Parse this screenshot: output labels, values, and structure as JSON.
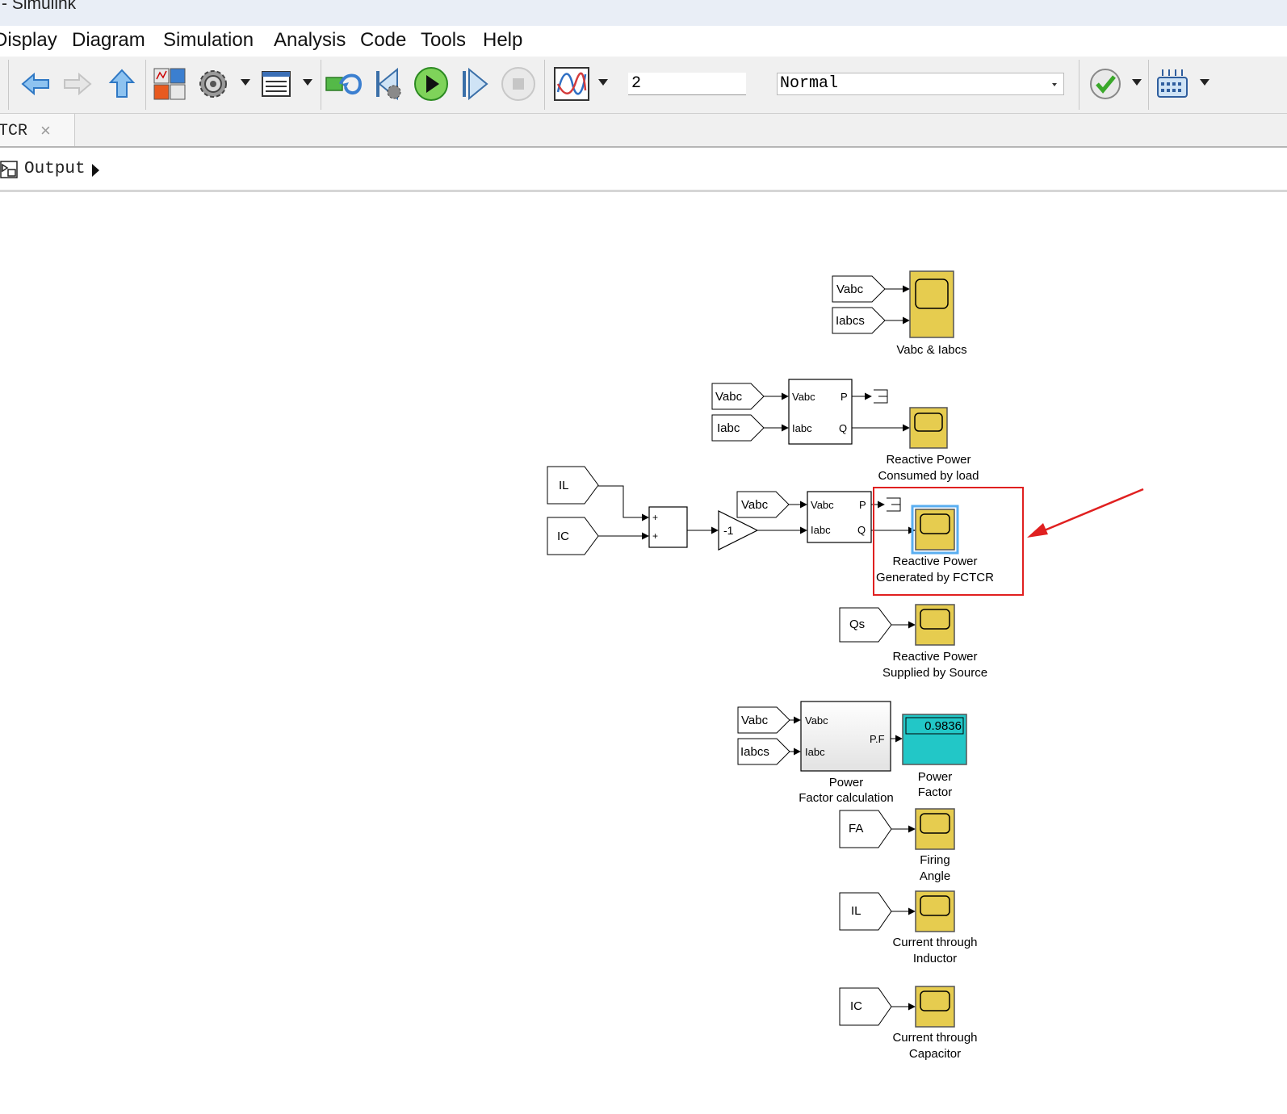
{
  "window": {
    "title": "- Simulink"
  },
  "menu": [
    "Display",
    "Diagram",
    "Simulation",
    "Analysis",
    "Code",
    "Tools",
    "Help"
  ],
  "toolbar": {
    "stop_time": "2",
    "sim_mode": "Normal",
    "icons": [
      "back-icon",
      "forward-icon",
      "up-icon",
      "library-browser-icon",
      "model-settings-icon",
      "model-explorer-icon",
      "build-icon",
      "step-back-icon",
      "run-icon",
      "step-forward-icon",
      "stop-icon",
      "data-inspector-icon",
      "model-advisor-icon",
      "hardware-icon"
    ]
  },
  "tab": {
    "label": "TCR",
    "close": "×"
  },
  "breadcrumb": {
    "label": "Output"
  },
  "diagram": {
    "goto_tags": {
      "g1a": "Vabc",
      "g1b": "Iabcs",
      "g2a": "Vabc",
      "g2b": "Iabc",
      "g3a": "IL",
      "g3b": "IC",
      "g3c": "Vabc",
      "g4": "Qs",
      "g5a": "Vabc",
      "g5b": "Iabcs",
      "g6": "FA",
      "g7": "IL",
      "g8": "IC"
    },
    "pq1": {
      "in1": "Vabc",
      "in2": "Iabc",
      "out1": "P",
      "out2": "Q"
    },
    "pq2": {
      "in1": "Vabc",
      "in2": "Iabc",
      "out1": "P",
      "out2": "Q"
    },
    "sum": {
      "s1": "+",
      "s2": "+"
    },
    "gain": "-1",
    "pf_calc": {
      "in1": "Vabc",
      "in2": "Iabc",
      "out": "P.F",
      "label1": "Power",
      "label2": "Factor calculation"
    },
    "display": {
      "value": "0.9836",
      "label1": "Power",
      "label2": "Factor"
    },
    "scopes": {
      "vabc_iabcs": "Vabc & Iabcs",
      "q_load_1": "Reactive Power",
      "q_load_2": "Consumed by load",
      "q_fctcr_1": "Reactive Power",
      "q_fctcr_2": "Generated by FCTCR",
      "q_source_1": "Reactive Power",
      "q_source_2": "Supplied by Source",
      "fa_1": "Firing",
      "fa_2": "Angle",
      "il_1": "Current through",
      "il_2": "Inductor",
      "ic_1": "Current through",
      "ic_2": "Capacitor"
    }
  },
  "colors": {
    "scope": "#e6cc4f",
    "display": "#22c7c7",
    "highlight": "#e02020"
  }
}
